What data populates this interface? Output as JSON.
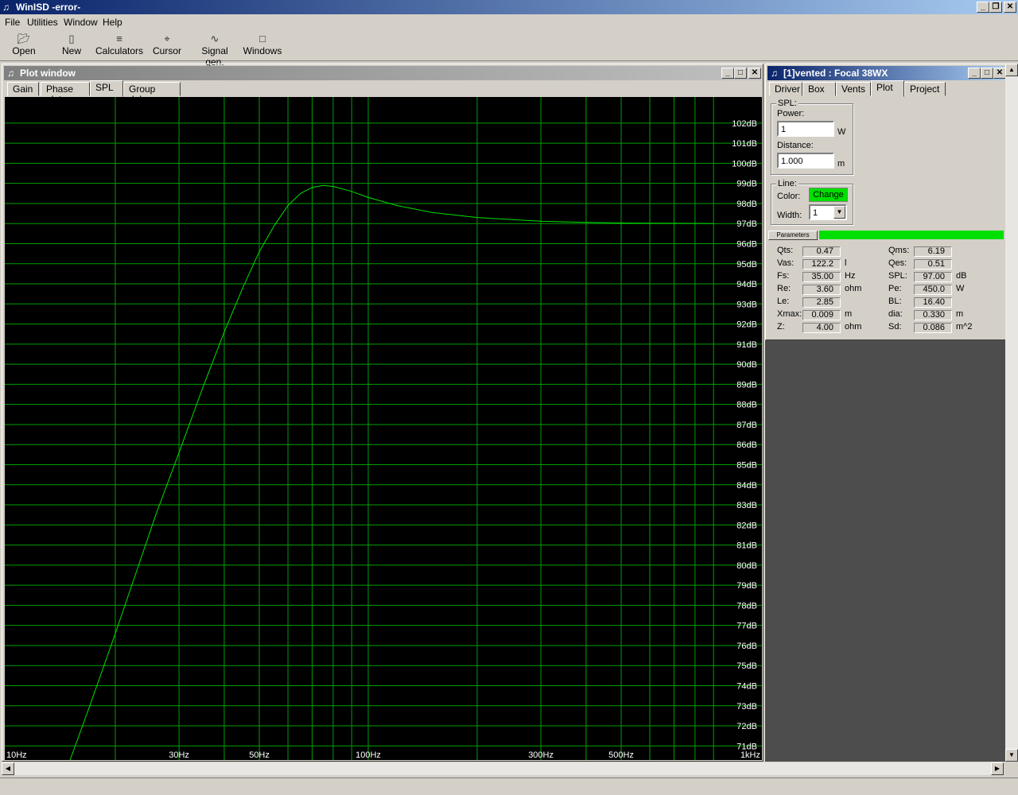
{
  "window": {
    "title": "WinISD -error-"
  },
  "menu": [
    "File",
    "Utilities",
    "Window",
    "Help"
  ],
  "toolbar": [
    {
      "label": "Open",
      "icon": "folder-open-icon"
    },
    {
      "label": "New",
      "icon": "new-document-icon"
    },
    {
      "label": "Calculators",
      "icon": "calculator-icon"
    },
    {
      "label": "Cursor",
      "icon": "crosshair-icon"
    },
    {
      "label": "Signal gen.",
      "icon": "signal-generator-icon"
    },
    {
      "label": "Windows",
      "icon": "windows-icon"
    }
  ],
  "plot_window": {
    "title": "Plot window",
    "tabs": [
      "Gain",
      "Phase plot",
      "SPL",
      "Group delay"
    ],
    "active_tab": "SPL"
  },
  "chart_data": {
    "type": "line",
    "xscale": "log",
    "xlim": [
      10,
      1000
    ],
    "ylim": [
      70.3,
      103.3
    ],
    "x_tick_labels": [
      {
        "value": 10,
        "label": "10Hz"
      },
      {
        "value": 30,
        "label": "30Hz"
      },
      {
        "value": 50,
        "label": "50Hz"
      },
      {
        "value": 100,
        "label": "100Hz"
      },
      {
        "value": 300,
        "label": "300Hz"
      },
      {
        "value": 500,
        "label": "500Hz"
      },
      {
        "value": 1000,
        "label": "1kHz"
      }
    ],
    "x_gridlines": [
      20,
      30,
      40,
      50,
      60,
      70,
      80,
      90,
      100,
      200,
      300,
      400,
      500,
      600,
      700,
      800,
      900
    ],
    "y_ticks": [
      71,
      72,
      73,
      74,
      75,
      76,
      77,
      78,
      79,
      80,
      81,
      82,
      83,
      84,
      85,
      86,
      87,
      88,
      89,
      90,
      91,
      92,
      93,
      94,
      95,
      96,
      97,
      98,
      99,
      100,
      101,
      102
    ],
    "y_unit": "dB",
    "grid": true,
    "series": [
      {
        "color": "#00e000",
        "x": [
          15,
          17,
          20,
          23,
          26,
          30,
          35,
          40,
          45,
          50,
          55,
          60,
          65,
          70,
          75,
          80,
          90,
          100,
          120,
          150,
          200,
          250,
          300,
          400,
          500,
          600,
          800,
          900
        ],
        "y": [
          70.3,
          73.0,
          76.6,
          79.8,
          82.6,
          85.6,
          88.9,
          91.6,
          93.8,
          95.6,
          96.9,
          97.9,
          98.5,
          98.8,
          98.9,
          98.85,
          98.6,
          98.3,
          97.9,
          97.55,
          97.3,
          97.2,
          97.12,
          97.06,
          97.03,
          97.02,
          97.01,
          97.0
        ]
      }
    ]
  },
  "driver_window": {
    "title": "[1]vented : Focal 38WX",
    "tabs": [
      "Driver",
      "Box",
      "Vents",
      "Plot",
      "Project"
    ],
    "active_tab": "Plot",
    "spl": {
      "legend": "SPL:",
      "power_label": "Power:",
      "power_value": "1",
      "power_unit": "W",
      "distance_label": "Distance:",
      "distance_value": "1.000",
      "distance_unit": "m"
    },
    "line": {
      "legend": "Line:",
      "color_label": "Color:",
      "change_label": "Change",
      "width_label": "Width:",
      "width_value": "1",
      "color": "#00e000"
    },
    "parameters_tab": "Parameters",
    "params_left": [
      {
        "label": "Qts:",
        "value": "0.47",
        "unit": ""
      },
      {
        "label": "Vas:",
        "value": "122.2",
        "unit": "l"
      },
      {
        "label": "Fs:",
        "value": "35.00",
        "unit": "Hz"
      },
      {
        "label": "Re:",
        "value": "3.60",
        "unit": "ohm"
      },
      {
        "label": "Le:",
        "value": "2.85",
        "unit": ""
      },
      {
        "label": "Xmax:",
        "value": "0.009",
        "unit": "m"
      },
      {
        "label": "Z:",
        "value": "4.00",
        "unit": "ohm"
      }
    ],
    "params_right": [
      {
        "label": "Qms:",
        "value": "6.19",
        "unit": ""
      },
      {
        "label": "Qes:",
        "value": "0.51",
        "unit": ""
      },
      {
        "label": "SPL:",
        "value": "97.00",
        "unit": "dB"
      },
      {
        "label": "Pe:",
        "value": "450.0",
        "unit": "W"
      },
      {
        "label": "BL:",
        "value": "16.40",
        "unit": ""
      },
      {
        "label": "dia:",
        "value": "0.330",
        "unit": "m"
      },
      {
        "label": "Sd:",
        "value": "0.086",
        "unit": "m^2"
      }
    ]
  }
}
